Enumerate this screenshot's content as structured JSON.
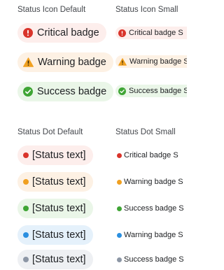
{
  "colors": {
    "critical": "#d9342b",
    "warning": "#f0a020",
    "success": "#3fa535",
    "info": "#2b8fe0",
    "neutral": "#8c96a5"
  },
  "sections": {
    "icon_default_title": "Status Icon Default",
    "icon_small_title": "Status Icon Small",
    "dot_default_title": "Status Dot Default",
    "dot_small_title": "Status Dot Small"
  },
  "icon_default": [
    {
      "label": "Critical badge",
      "icon": "exclamation-circle-icon"
    },
    {
      "label": "Warning badge",
      "icon": "warning-triangle-icon"
    },
    {
      "label": "Success badge",
      "icon": "check-circle-icon"
    }
  ],
  "icon_small": [
    {
      "label": "Critical badge S",
      "icon": "exclamation-circle-icon"
    },
    {
      "label": "Warning badge S",
      "icon": "warning-triangle-icon"
    },
    {
      "label": "Success badge S",
      "icon": "check-circle-icon"
    }
  ],
  "dot_default": [
    {
      "label": "[Status text]",
      "status": "critical"
    },
    {
      "label": "[Status text]",
      "status": "warning"
    },
    {
      "label": "[Status text]",
      "status": "success"
    },
    {
      "label": "[Status text]",
      "status": "info"
    },
    {
      "label": "[Status text]",
      "status": "neutral"
    }
  ],
  "dot_small": [
    {
      "label": "Critical badge S",
      "status": "critical"
    },
    {
      "label": "Warning badge S",
      "status": "warning"
    },
    {
      "label": "Success badge S",
      "status": "success"
    },
    {
      "label": "Warning badge S",
      "status": "info"
    },
    {
      "label": "Success badge S",
      "status": "neutral"
    }
  ]
}
